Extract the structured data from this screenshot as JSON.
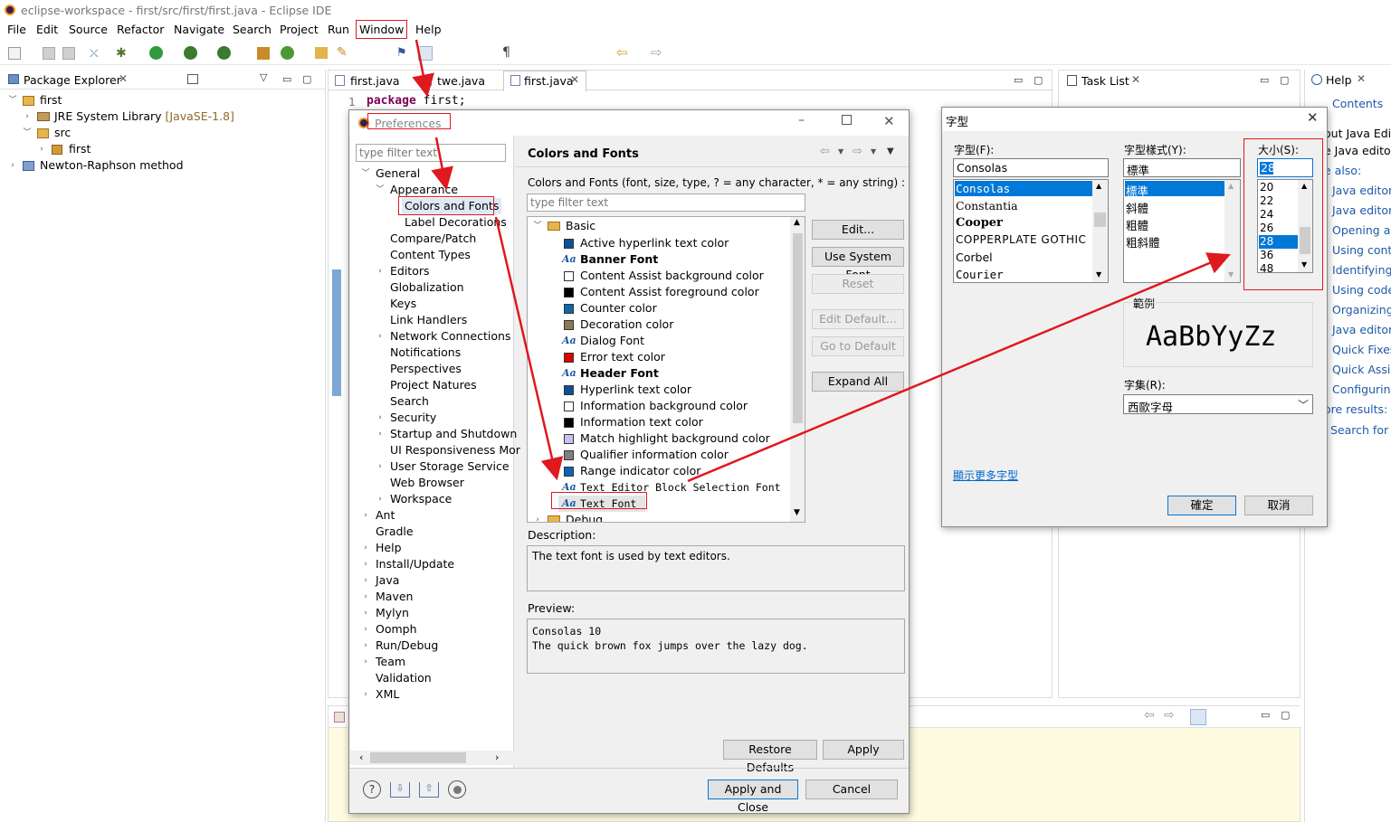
{
  "window": {
    "title": "eclipse-workspace - first/src/first/first.java - Eclipse IDE"
  },
  "menu": [
    "File",
    "Edit",
    "Source",
    "Refactor",
    "Navigate",
    "Search",
    "Project",
    "Run",
    "Window",
    "Help"
  ],
  "package_explorer": {
    "title": "Package Explorer",
    "items": [
      {
        "label": "first",
        "extra": ""
      },
      {
        "label": "JRE System Library",
        "extra": "[JavaSE-1.8]"
      },
      {
        "label": "src",
        "extra": ""
      },
      {
        "label": "first",
        "extra": ""
      },
      {
        "label": "Newton-Raphson method",
        "extra": ""
      }
    ]
  },
  "editor": {
    "tabs": [
      "first.java",
      "twe.java",
      "first.java"
    ],
    "line_number": "1",
    "code_keyword": "package",
    "code_rest": " first;"
  },
  "task_list": {
    "title": "Task List"
  },
  "help": {
    "title": "Help",
    "contents_label": "Contents",
    "lines": [
      "out Java Edi",
      "e Java editor",
      "e also:"
    ],
    "links": [
      "Java editor",
      "Java editor",
      "Opening a J",
      "Using conte",
      "Identifying",
      "Using code",
      "Organizing",
      "Java editor",
      "Quick Fixes",
      "Quick Assist",
      "Configuring"
    ],
    "more_results": "ore results:",
    "search_for": "Search for Ja"
  },
  "preferences": {
    "title": "Preferences",
    "filter_placeholder": "type filter text",
    "tree": [
      {
        "label": "General",
        "level": 0,
        "chev": "open"
      },
      {
        "label": "Appearance",
        "level": 1,
        "chev": "open"
      },
      {
        "label": "Colors and Fonts",
        "level": 2,
        "chev": "none"
      },
      {
        "label": "Label Decorations",
        "level": 2,
        "chev": "none"
      },
      {
        "label": "Compare/Patch",
        "level": 1,
        "chev": "none"
      },
      {
        "label": "Content Types",
        "level": 1,
        "chev": "none"
      },
      {
        "label": "Editors",
        "level": 1,
        "chev": "closed"
      },
      {
        "label": "Globalization",
        "level": 1,
        "chev": "none"
      },
      {
        "label": "Keys",
        "level": 1,
        "chev": "none"
      },
      {
        "label": "Link Handlers",
        "level": 1,
        "chev": "none"
      },
      {
        "label": "Network Connections",
        "level": 1,
        "chev": "closed"
      },
      {
        "label": "Notifications",
        "level": 1,
        "chev": "none"
      },
      {
        "label": "Perspectives",
        "level": 1,
        "chev": "none"
      },
      {
        "label": "Project Natures",
        "level": 1,
        "chev": "none"
      },
      {
        "label": "Search",
        "level": 1,
        "chev": "none"
      },
      {
        "label": "Security",
        "level": 1,
        "chev": "closed"
      },
      {
        "label": "Startup and Shutdown",
        "level": 1,
        "chev": "closed"
      },
      {
        "label": "UI Responsiveness Mor",
        "level": 1,
        "chev": "none"
      },
      {
        "label": "User Storage Service",
        "level": 1,
        "chev": "closed"
      },
      {
        "label": "Web Browser",
        "level": 1,
        "chev": "none"
      },
      {
        "label": "Workspace",
        "level": 1,
        "chev": "closed"
      },
      {
        "label": "Ant",
        "level": 0,
        "chev": "closed"
      },
      {
        "label": "Gradle",
        "level": 0,
        "chev": "none"
      },
      {
        "label": "Help",
        "level": 0,
        "chev": "closed"
      },
      {
        "label": "Install/Update",
        "level": 0,
        "chev": "closed"
      },
      {
        "label": "Java",
        "level": 0,
        "chev": "closed"
      },
      {
        "label": "Maven",
        "level": 0,
        "chev": "closed"
      },
      {
        "label": "Mylyn",
        "level": 0,
        "chev": "closed"
      },
      {
        "label": "Oomph",
        "level": 0,
        "chev": "closed"
      },
      {
        "label": "Run/Debug",
        "level": 0,
        "chev": "closed"
      },
      {
        "label": "Team",
        "level": 0,
        "chev": "closed"
      },
      {
        "label": "Validation",
        "level": 0,
        "chev": "none"
      },
      {
        "label": "XML",
        "level": 0,
        "chev": "closed"
      }
    ],
    "page_title": "Colors and Fonts",
    "page_desc": "Colors and Fonts (font, size, type, ? = any character, * = any string) :",
    "page_filter_placeholder": "type filter text",
    "category": "Basic",
    "items": [
      {
        "label": "Active hyperlink text color",
        "kind": "swatch",
        "color": "#0f4f9a",
        "bold": false
      },
      {
        "label": "Banner Font",
        "kind": "font",
        "color": "",
        "bold": true
      },
      {
        "label": "Content Assist background color",
        "kind": "swatch",
        "color": "#ffffff",
        "bold": false
      },
      {
        "label": "Content Assist foreground color",
        "kind": "swatch",
        "color": "#000000",
        "bold": false
      },
      {
        "label": "Counter color",
        "kind": "swatch",
        "color": "#0b69a6",
        "bold": false
      },
      {
        "label": "Decoration color",
        "kind": "swatch",
        "color": "#8a7a55",
        "bold": false
      },
      {
        "label": "Dialog Font",
        "kind": "font",
        "color": "",
        "bold": false
      },
      {
        "label": "Error text color",
        "kind": "swatch",
        "color": "#e00000",
        "bold": false
      },
      {
        "label": "Header Font",
        "kind": "font",
        "color": "",
        "bold": true
      },
      {
        "label": "Hyperlink text color",
        "kind": "swatch",
        "color": "#0f4f9a",
        "bold": false
      },
      {
        "label": "Information background color",
        "kind": "swatch",
        "color": "#ffffff",
        "bold": false
      },
      {
        "label": "Information text color",
        "kind": "swatch",
        "color": "#000000",
        "bold": false
      },
      {
        "label": "Match highlight background color",
        "kind": "swatch",
        "color": "#c8c3ea",
        "bold": false
      },
      {
        "label": "Qualifier information color",
        "kind": "swatch",
        "color": "#808080",
        "bold": false
      },
      {
        "label": "Range indicator color",
        "kind": "swatch",
        "color": "#0d62b8",
        "bold": false
      },
      {
        "label": "Text Editor Block Selection Font",
        "kind": "font",
        "color": "",
        "bold": false,
        "mono": true
      },
      {
        "label": "Text Font",
        "kind": "font",
        "color": "",
        "bold": false,
        "mono": true
      }
    ],
    "debug_label": "Debug",
    "buttons": {
      "edit": "Edit...",
      "use_system_font": "Use System Font",
      "reset": "Reset",
      "edit_default": "Edit Default...",
      "go_to_default": "Go to Default",
      "expand_all": "Expand All",
      "restore_defaults": "Restore Defaults",
      "apply": "Apply",
      "apply_and_close": "Apply and Close",
      "cancel": "Cancel"
    },
    "description_label": "Description:",
    "description_text": "The text font is used by text editors.",
    "preview_label": "Preview:",
    "preview_line1": "Consolas 10",
    "preview_line2": "The quick brown fox jumps over the lazy dog."
  },
  "font_dialog": {
    "title": "字型",
    "font_label": "字型(F):",
    "font_value": "Consolas",
    "fonts": [
      "Consolas",
      "Constantia",
      "Cooper",
      "COPPERPLATE GOTHIC",
      "Corbel",
      "Courier"
    ],
    "style_label": "字型樣式(Y):",
    "style_value": "標準",
    "styles": [
      "標準",
      "斜體",
      "粗體",
      "粗斜體"
    ],
    "size_label": "大小(S):",
    "size_value": "28",
    "sizes": [
      "20",
      "22",
      "24",
      "26",
      "28",
      "36",
      "48"
    ],
    "sample_label": "範例",
    "sample_text": "AaBbYyZz",
    "script_label": "字集(R):",
    "script_value": "西歐字母",
    "more_fonts": "顯示更多字型",
    "ok": "確定",
    "cancel": "取消"
  }
}
